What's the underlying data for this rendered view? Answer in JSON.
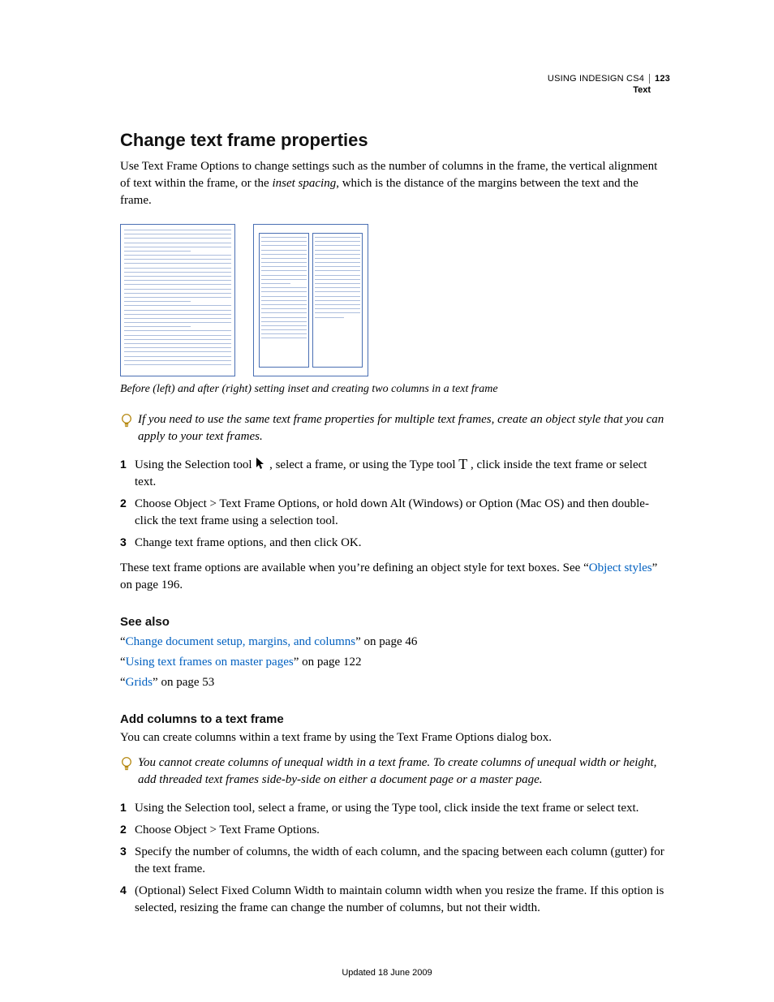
{
  "header": {
    "title": "USING INDESIGN CS4",
    "page_number": "123",
    "section": "Text"
  },
  "h1": "Change text frame properties",
  "intro_a": "Use Text Frame Options to change settings such as the number of columns in the frame, the vertical alignment of text within the frame, or the ",
  "intro_em": "inset spacing",
  "intro_b": ", which is the distance of the margins between the text and the frame.",
  "caption": "Before (left) and after (right) setting inset and creating two columns in a text frame",
  "tip1": "If you need to use the same text frame properties for multiple text frames, create an object style that you can apply to your text frames.",
  "steps1": {
    "s1a": "Using the Selection tool ",
    "s1b": " , select a frame, or using the Type tool ",
    "s1c": " , click inside the text frame or select text.",
    "s2": "Choose Object > Text Frame Options, or hold down Alt (Windows) or Option (Mac OS) and then double-click the text frame using a selection tool.",
    "s3": "Change text frame options, and then click OK."
  },
  "after1a": "These text frame options are available when you’re defining an object style for text boxes. See ",
  "after1_link": "Object styles",
  "after1b": " on page 196.",
  "seealso_h": "See also",
  "seealso": {
    "l1_link": "Change document setup, margins, and columns",
    "l1_tail": " on page 46",
    "l2_link": "Using text frames on master pages",
    "l2_tail": " on page 122",
    "l3_link": "Grids",
    "l3_tail": " on page 53"
  },
  "h2b": "Add columns to a text frame",
  "addcol_intro": "You can create columns within a text frame by using the Text Frame Options dialog box.",
  "tip2": "You cannot create columns of unequal width in a text frame. To create columns of unequal width or height, add threaded text frames side-by-side on either a document page or a master page.",
  "steps2": {
    "s1": "Using the Selection tool, select a frame, or using the Type tool, click inside the text frame or select text.",
    "s2": "Choose Object > Text Frame Options.",
    "s3": "Specify the number of columns, the width of each column, and the spacing between each column (gutter) for the text frame.",
    "s4": "(Optional) Select Fixed Column Width to maintain column width when you resize the frame. If this option is selected, resizing the frame can change the number of columns, but not their width."
  },
  "footer": "Updated 18 June 2009",
  "nums": {
    "n1": "1",
    "n2": "2",
    "n3": "3",
    "n4": "4"
  },
  "q_open": "“",
  "q_close": "”"
}
